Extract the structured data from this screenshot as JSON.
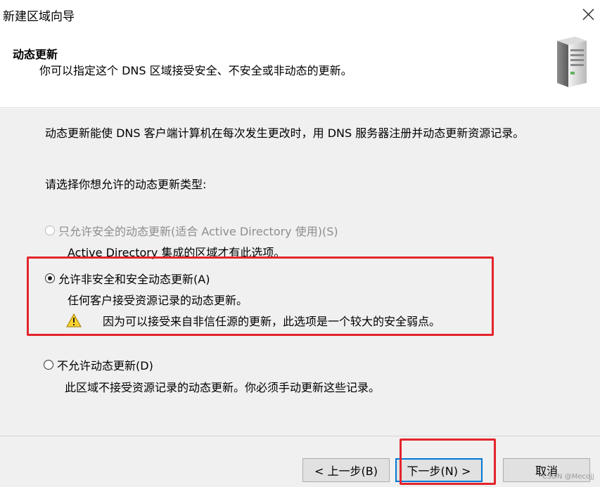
{
  "window": {
    "title": "新建区域向导",
    "close_icon": "close-icon"
  },
  "header": {
    "title": "动态更新",
    "subtitle": "你可以指定这个 DNS 区域接受安全、不安全或非动态的更新。",
    "icon": "server-icon"
  },
  "body": {
    "description": "动态更新能使 DNS 客户端计算机在每次发生更改时，用 DNS 服务器注册并动态更新资源记录。",
    "prompt": "请选择你想允许的动态更新类型:",
    "options": [
      {
        "label": "只允许安全的动态更新(适合 Active Directory 使用)(S)",
        "detail": "Active Directory 集成的区域才有此选项。",
        "checked": false,
        "disabled": true
      },
      {
        "label": "允许非安全和安全动态更新(A)",
        "detail": "任何客户接受资源记录的动态更新。",
        "warning": "因为可以接受来自非信任源的更新，此选项是一个较大的安全弱点。",
        "warning_icon": "warning-icon",
        "checked": true,
        "disabled": false
      },
      {
        "label": "不允许动态更新(D)",
        "detail": "此区域不接受资源记录的动态更新。你必须手动更新这些记录。",
        "checked": false,
        "disabled": false
      }
    ]
  },
  "footer": {
    "back_label": "< 上一步(B)",
    "next_label": "下一步(N) >",
    "cancel_label": "取消",
    "watermark": "CSDN @Mecojj"
  },
  "colors": {
    "highlight_box": "#e3242b",
    "body_bg": "#f0f0f0",
    "button_bg": "#e1e1e1",
    "focus_border": "#0078d7"
  }
}
